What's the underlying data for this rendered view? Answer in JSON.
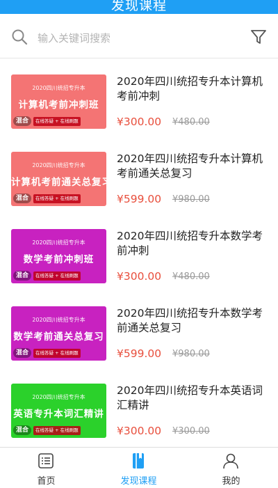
{
  "header": {
    "title": "发现课程"
  },
  "search": {
    "placeholder": "输入关键词搜索",
    "icon": "search-icon",
    "filter_icon": "filter-icon"
  },
  "accent_color": "#1f9ff4",
  "price_color": "#e84e3c",
  "courses": [
    {
      "name": "2020年四川统招专升本计算机考前冲刺",
      "price": "¥300.00",
      "original_price": "¥480.00",
      "thumb": {
        "line1": "2020四川统招专升本",
        "line2": "计算机考前冲刺班",
        "badge": "混合",
        "features": "在线答疑 + 在线刷题",
        "color": "#f47474"
      }
    },
    {
      "name": "2020年四川统招专升本计算机考前通关总复习",
      "price": "¥599.00",
      "original_price": "¥980.00",
      "thumb": {
        "line1": "2020四川统招专升本",
        "line2": "计算机考前通关总复习",
        "badge": "混合",
        "features": "在线答疑 + 在线刷题",
        "color": "#f47474"
      }
    },
    {
      "name": "2020年四川统招专升本数学考前冲刺",
      "price": "¥300.00",
      "original_price": "¥480.00",
      "thumb": {
        "line1": "2020四川统招专升本",
        "line2": "数学考前冲刺班",
        "badge": "混合",
        "features": "在线答疑 + 在线刷题",
        "color": "#c822c0"
      }
    },
    {
      "name": "2020年四川统招专升本数学考前通关总复习",
      "price": "¥599.00",
      "original_price": "¥980.00",
      "thumb": {
        "line1": "2020四川统招专升本",
        "line2": "数学考前通关总复习",
        "badge": "混合",
        "features": "在线答疑 + 在线刷题",
        "color": "#c822c0"
      }
    },
    {
      "name": "2020年四川统招专升本英语词汇精讲",
      "price": "¥300.00",
      "original_price": "¥300.00",
      "thumb": {
        "line1": "2020四川统招专升本",
        "line2": "英语专升本词汇精讲",
        "badge": "混合",
        "features": "在线答疑 + 在线刷题",
        "color": "#2bd12b"
      }
    }
  ],
  "tabbar": {
    "items": [
      {
        "label": "首页",
        "icon": "home-list-icon"
      },
      {
        "label": "发现课程",
        "icon": "book-icon",
        "active": true
      },
      {
        "label": "我的",
        "icon": "profile-icon"
      }
    ]
  }
}
